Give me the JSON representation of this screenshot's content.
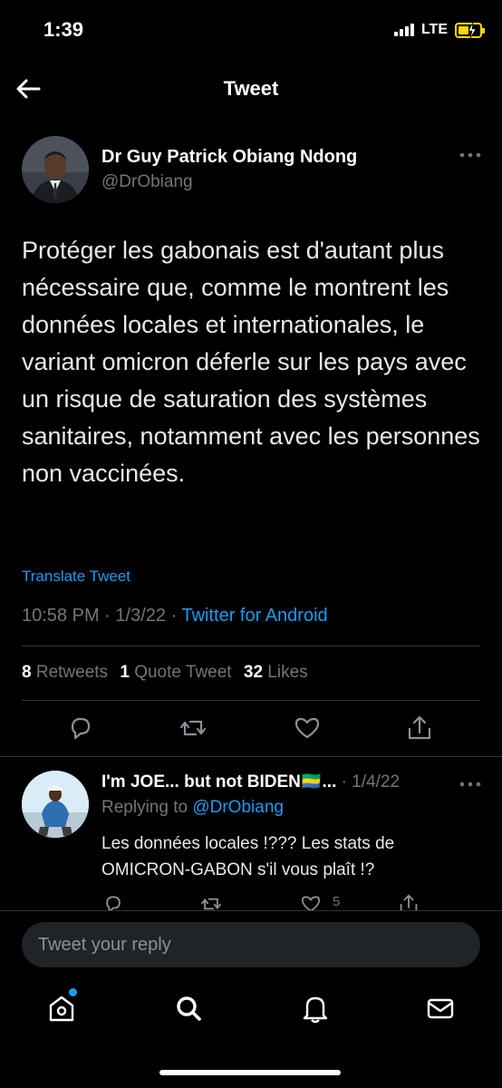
{
  "status_bar": {
    "time": "1:39",
    "network": "LTE"
  },
  "header": {
    "title": "Tweet"
  },
  "tweet": {
    "author_name": "Dr Guy Patrick Obiang Ndong",
    "author_handle": "@DrObiang",
    "text": "Protéger les gabonais est d'autant plus nécessaire que, comme le montrent les données locales et internationales, le variant omicron déferle  sur les pays avec un risque de saturation des systèmes sanitaires, notamment avec les personnes non vaccinées.",
    "translate_label": "Translate Tweet",
    "time": "10:58 PM",
    "date": "1/3/22",
    "source": "Twitter for Android",
    "separator": "·",
    "retweets_count": "8",
    "retweets_label": "Retweets",
    "quotes_count": "1",
    "quotes_label": "Quote Tweet",
    "likes_count": "32",
    "likes_label": "Likes"
  },
  "reply": {
    "author_name": "I'm JOE... but not BIDEN🇬🇦...",
    "date": "· 1/4/22",
    "replying_label": "Replying to",
    "replying_to": "@DrObiang",
    "text": "Les données locales !???  Les stats de OMICRON-GABON s'il vous plaît !?",
    "like_count": "5"
  },
  "composer": {
    "placeholder": "Tweet your reply"
  },
  "tabs": [
    "home-tab",
    "search-tab",
    "notifications-tab",
    "messages-tab"
  ],
  "colors": {
    "background": "#000000",
    "accent": "#1d9bf0",
    "muted": "#71767b",
    "text": "#e7e9ea",
    "battery": "#ffd60a"
  }
}
